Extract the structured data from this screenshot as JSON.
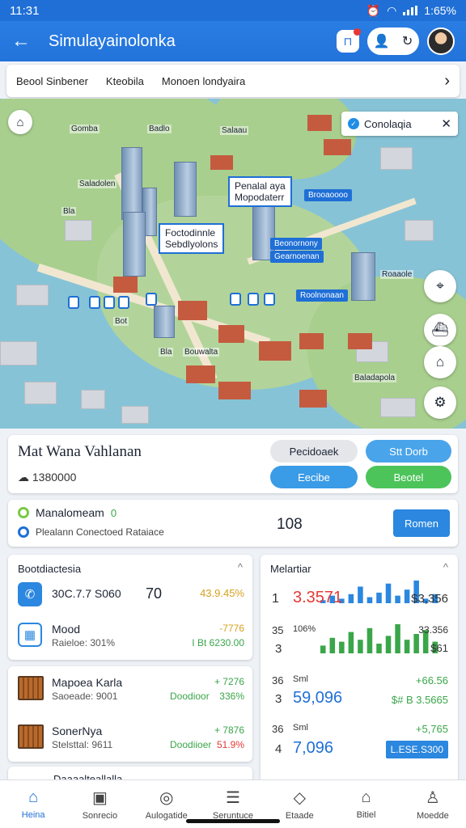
{
  "status_bar": {
    "time": "11:31",
    "battery": "1:65%"
  },
  "app_bar": {
    "title": "Simulayainolonka"
  },
  "search_row": {
    "field1": "Beool Sinbener",
    "field2": "Kteobila",
    "field3": "Monoen londyaira"
  },
  "map": {
    "chip_label": "Conolaqia",
    "callouts": [
      {
        "line1": "Penalal aya",
        "line2": "Mopodaterr"
      },
      {
        "line1": "Foctodinnle",
        "line2": "Sebdlyolons"
      }
    ],
    "tags": [
      "Brooaoooo",
      "Beonornony",
      "Gearnoenan",
      "Roolnonaan"
    ],
    "labels": [
      "Gomba",
      "Badlo",
      "Salaau",
      "Saladolen",
      "Bla",
      "Roaaole",
      "Baladapola",
      "Bouwalta",
      "Bot",
      "Bla"
    ]
  },
  "property_card": {
    "name": "Mat Wana Vahlanan",
    "meta": "1380000",
    "buttons": [
      "Pecidoaek",
      "Stt Dorb",
      "Eecibe",
      "Beotel"
    ]
  },
  "info_card": {
    "line1": "Manalomeam",
    "line1_badge": "0",
    "line2": "Plealann Conectoed Rataiace",
    "number": "108",
    "button": "Romen"
  },
  "left_panel": {
    "title": "Bootdiactesia",
    "rows": [
      {
        "value": "30C.7.7 S060",
        "mid": "70",
        "change": "43.9.45%"
      },
      {
        "title": "Mood",
        "sub": "Raieloe: 301%",
        "v1": "-7776",
        "v2": "I Bt 6230.00"
      }
    ]
  },
  "left_panel2": {
    "rows": [
      {
        "title": "Mapoea Karla",
        "sub": "Saoeade: 9001",
        "mid": "Doodioor",
        "v1": "+ 7276",
        "v2": "336%"
      },
      {
        "title": "SonerNya",
        "sub": "Stelsttal: 9611",
        "mid": "Doodiioer",
        "v1": "+ 7876",
        "v2": "51.9%"
      }
    ]
  },
  "left_panel3": {
    "title": "Daaaalteallalla"
  },
  "right_panel": {
    "title": "Melartiar",
    "rows": [
      {
        "left": "1",
        "value": "3.3571",
        "right": "$3,356"
      },
      {
        "left": "35",
        "mid": "106%",
        "right": "33.356"
      },
      {
        "left": "3",
        "right": "$61"
      },
      {
        "left": "36",
        "mid": "Sml",
        "right": "+66.56"
      },
      {
        "left": "3",
        "value": "59,096",
        "right": "$# B 3.5665"
      },
      {
        "left": "36",
        "mid": "Sml",
        "right": "+5,765"
      },
      {
        "left": "4",
        "value": "7,096",
        "tag": "L.ESE.S300"
      }
    ]
  },
  "chart_data": {
    "type": "bar",
    "series": [
      {
        "name": "",
        "values": [
          4,
          10,
          6,
          12,
          22,
          8,
          14,
          26,
          10,
          18,
          30,
          6,
          12
        ]
      },
      {
        "name": "",
        "values": [
          8,
          16,
          12,
          22,
          14,
          26,
          10,
          18,
          30,
          14,
          20,
          24,
          12
        ]
      }
    ]
  },
  "bottom_nav": [
    "Heina",
    "Sonrecio",
    "Aulogatide",
    "Seruntuce",
    "Etaade",
    "Bitiel",
    "Moedde"
  ]
}
